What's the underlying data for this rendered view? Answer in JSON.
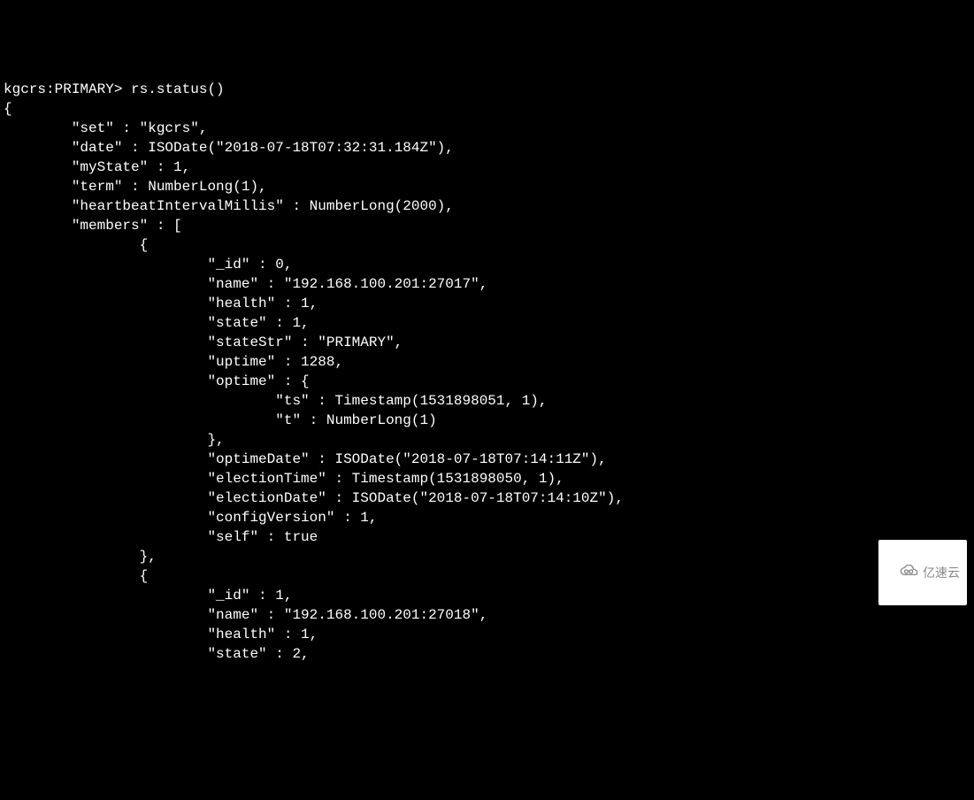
{
  "prompt": "kgcrs:PRIMARY> ",
  "command": "rs.status()",
  "lines": {
    "l00": "{",
    "l01": "        \"set\" : \"kgcrs\",",
    "l02": "        \"date\" : ISODate(\"2018-07-18T07:32:31.184Z\"),",
    "l03": "        \"myState\" : 1,",
    "l04": "        \"term\" : NumberLong(1),",
    "l05": "        \"heartbeatIntervalMillis\" : NumberLong(2000),",
    "l06": "        \"members\" : [",
    "l07": "                {",
    "l08": "                        \"_id\" : 0,",
    "l09": "                        \"name\" : \"192.168.100.201:27017\",",
    "l10": "                        \"health\" : 1,",
    "l11": "                        \"state\" : 1,",
    "l12": "                        \"stateStr\" : \"PRIMARY\",",
    "l13": "                        \"uptime\" : 1288,",
    "l14": "                        \"optime\" : {",
    "l15": "                                \"ts\" : Timestamp(1531898051, 1),",
    "l16": "                                \"t\" : NumberLong(1)",
    "l17": "                        },",
    "l18": "                        \"optimeDate\" : ISODate(\"2018-07-18T07:14:11Z\"),",
    "l19": "                        \"electionTime\" : Timestamp(1531898050, 1),",
    "l20": "                        \"electionDate\" : ISODate(\"2018-07-18T07:14:10Z\"),",
    "l21": "                        \"configVersion\" : 1,",
    "l22": "                        \"self\" : true",
    "l23": "                },",
    "l24": "                {",
    "l25": "                        \"_id\" : 1,",
    "l26": "                        \"name\" : \"192.168.100.201:27018\",",
    "l27": "                        \"health\" : 1,",
    "l28": "                        \"state\" : 2,"
  },
  "watermark": {
    "text": "亿速云"
  }
}
